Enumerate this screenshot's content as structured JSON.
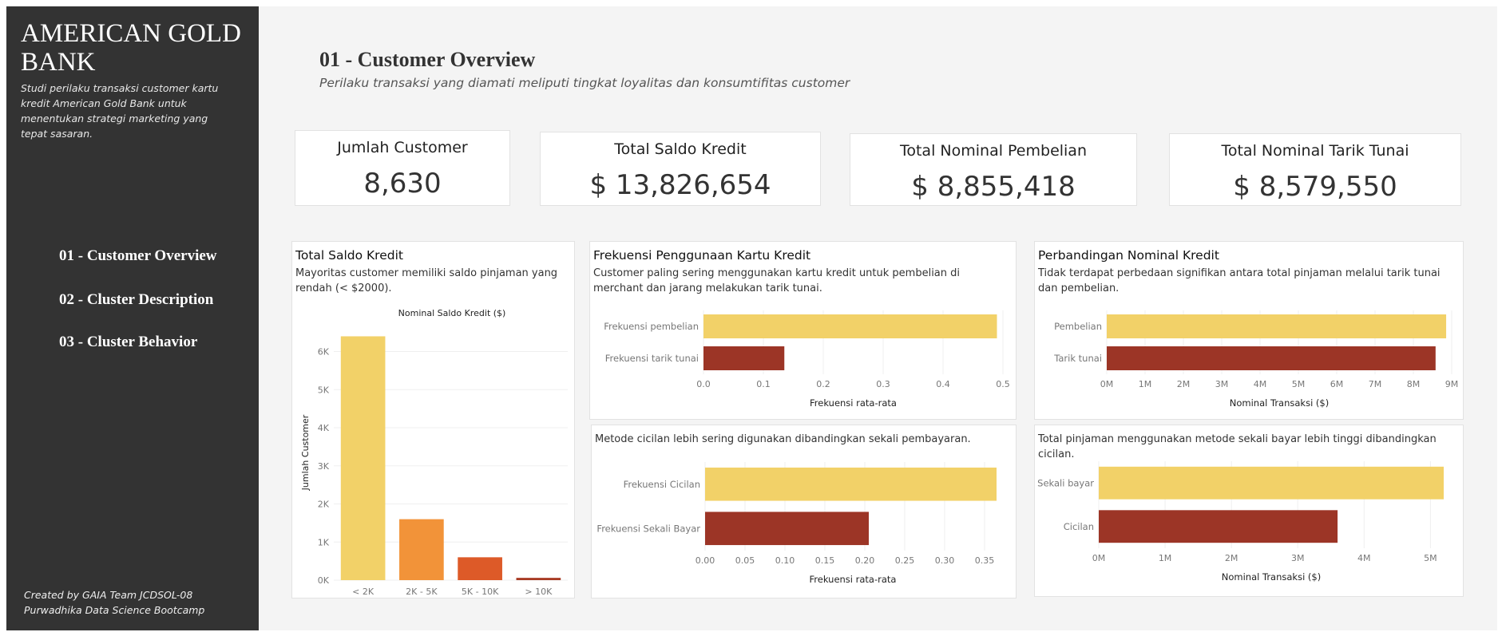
{
  "sidebar": {
    "brand": "AMERICAN GOLD BANK",
    "description": "Studi perilaku transaksi customer kartu kredit American Gold Bank untuk menentukan strategi marketing yang tepat sasaran.",
    "nav": [
      {
        "label": "01 - Customer Overview"
      },
      {
        "label": "02 - Cluster Description"
      },
      {
        "label": "03 - Cluster Behavior"
      }
    ],
    "credits_line1": "Created by GAIA Team JCDSOL-08",
    "credits_line2": "Purwadhika Data Science Bootcamp"
  },
  "page": {
    "title": "01 - Customer Overview",
    "subtitle": "Perilaku transaksi yang diamati meliputi  tingkat loyalitas dan konsumtifitas customer"
  },
  "kpis": [
    {
      "label": "Jumlah Customer",
      "value": "8,630"
    },
    {
      "label": "Total Saldo Kredit",
      "value": "$ 13,826,654"
    },
    {
      "label": "Total Nominal Pembelian",
      "value": "$ 8,855,418"
    },
    {
      "label": "Total Nominal Tarik Tunai",
      "value": "$ 8,579,550"
    }
  ],
  "colors": {
    "yellow": "#f2d168",
    "red": "#9c3526",
    "orange": "#f29339",
    "darkorange": "#dd5a28",
    "brick": "#a83a23"
  },
  "panels": {
    "saldo": {
      "title": "Total Saldo Kredit",
      "desc": "Mayoritas customer memiliki saldo pinjaman yang rendah (< $2000)."
    },
    "frekuensi": {
      "title": "Frekuensi Penggunaan Kartu Kredit",
      "desc": "Customer paling sering menggunakan kartu kredit untuk pembelian di merchant dan jarang melakukan tarik tunai."
    },
    "perbandingan": {
      "title": "Perbandingan Nominal Kredit",
      "desc": "Tidak terdapat perbedaan signifikan antara total pinjaman melalui tarik tunai dan pembelian."
    },
    "cicilan": {
      "desc": "Metode cicilan lebih sering digunakan dibandingkan sekali pembayaran."
    },
    "sekali": {
      "desc": "Total pinjaman menggunakan metode sekali bayar lebih tinggi dibandingkan cicilan."
    }
  },
  "chart_data": [
    {
      "id": "saldo",
      "type": "bar",
      "title": "Nominal Saldo Kredit ($)",
      "xlabel": "",
      "ylabel": "Jumlah Customer",
      "categories": [
        "< 2K",
        "2K - 5K",
        "5K - 10K",
        "> 10K"
      ],
      "values": [
        6400,
        1600,
        600,
        60
      ],
      "colors": [
        "#f2d168",
        "#f29339",
        "#dd5a28",
        "#a83a23"
      ],
      "ylim": [
        0,
        6200
      ],
      "yticks": [
        0,
        1000,
        2000,
        3000,
        4000,
        5000,
        6000
      ],
      "ytick_labels": [
        "0K",
        "1K",
        "2K",
        "3K",
        "4K",
        "5K",
        "6K"
      ],
      "grid": true
    },
    {
      "id": "frekuensi",
      "type": "bar",
      "orientation": "horizontal",
      "categories": [
        "Frekuensi pembelian",
        "Frekuensi tarik tunai"
      ],
      "values": [
        0.49,
        0.135
      ],
      "colors": [
        "#f2d168",
        "#9c3526"
      ],
      "xlabel": "Frekuensi rata-rata",
      "xlim": [
        0,
        0.5
      ],
      "xticks": [
        0,
        0.1,
        0.2,
        0.3,
        0.4,
        0.5
      ],
      "xtick_labels": [
        "0.0",
        "0.1",
        "0.2",
        "0.3",
        "0.4",
        "0.5"
      ]
    },
    {
      "id": "perbandingan",
      "type": "bar",
      "orientation": "horizontal",
      "categories": [
        "Pembelian",
        "Tarik tunai"
      ],
      "values": [
        8855418,
        8579550
      ],
      "colors": [
        "#f2d168",
        "#9c3526"
      ],
      "xlabel": "Nominal Transaksi ($)",
      "xlim": [
        0,
        9000000
      ],
      "xticks": [
        0,
        1000000,
        2000000,
        3000000,
        4000000,
        5000000,
        6000000,
        7000000,
        8000000,
        9000000
      ],
      "xtick_labels": [
        "0M",
        "1M",
        "2M",
        "3M",
        "4M",
        "5M",
        "6M",
        "7M",
        "8M",
        "9M"
      ]
    },
    {
      "id": "cicilan",
      "type": "bar",
      "orientation": "horizontal",
      "categories": [
        "Frekuensi Cicilan",
        "Frekuensi Sekali Bayar"
      ],
      "values": [
        0.365,
        0.205
      ],
      "colors": [
        "#f2d168",
        "#9c3526"
      ],
      "xlabel": "Frekuensi rata-rata",
      "xlim": [
        0,
        0.37
      ],
      "xticks": [
        0,
        0.05,
        0.1,
        0.15,
        0.2,
        0.25,
        0.3,
        0.35
      ],
      "xtick_labels": [
        "0.00",
        "0.05",
        "0.10",
        "0.15",
        "0.20",
        "0.25",
        "0.30",
        "0.35"
      ]
    },
    {
      "id": "sekali",
      "type": "bar",
      "orientation": "horizontal",
      "categories": [
        "Sekali bayar",
        "Cicilan"
      ],
      "values": [
        5200000,
        3600000
      ],
      "colors": [
        "#f2d168",
        "#9c3526"
      ],
      "xlabel": "Nominal Transaksi ($)",
      "xlim": [
        0,
        5200000
      ],
      "xticks": [
        0,
        1000000,
        2000000,
        3000000,
        4000000,
        5000000
      ],
      "xtick_labels": [
        "0M",
        "1M",
        "2M",
        "3M",
        "4M",
        "5M"
      ]
    }
  ]
}
